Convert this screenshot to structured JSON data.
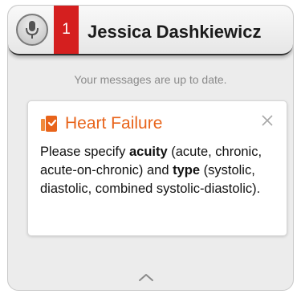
{
  "header": {
    "badge_count": "1",
    "patient_name": "Jessica Dashkiewicz"
  },
  "status": {
    "text": "Your messages are up to date."
  },
  "alert_card": {
    "title": "Heart Failure",
    "body": {
      "prefix": "Please specify ",
      "term1": "acuity",
      "term1_detail": " (acute, chronic, acute-on-chronic) and ",
      "term2": "type",
      "term2_detail": " (systolic, diastolic, combined systolic-diastolic)."
    }
  },
  "colors": {
    "badge_red": "#d51f1f",
    "title_orange": "#e8641b",
    "panel_bg": "#ececec"
  },
  "icons": {
    "mic": "microphone-icon",
    "alert": "document-alert-icon",
    "close": "close-icon",
    "expand": "chevron-up-icon"
  }
}
